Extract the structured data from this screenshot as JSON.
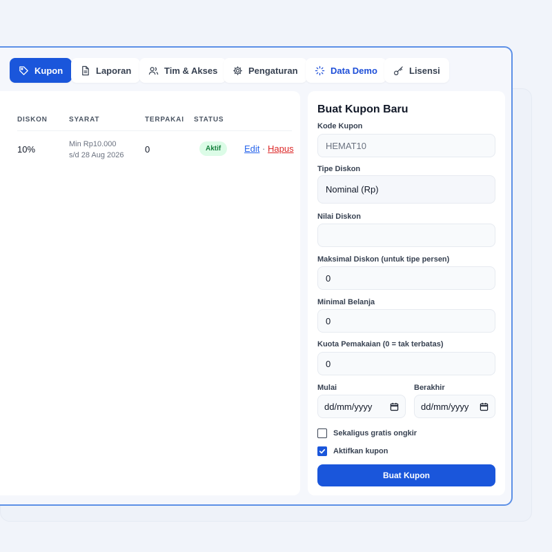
{
  "tabs": [
    {
      "label": "Kupon",
      "icon": "tag-icon"
    },
    {
      "label": "Laporan",
      "icon": "document-icon"
    },
    {
      "label": "Tim & Akses",
      "icon": "users-icon"
    },
    {
      "label": "Pengaturan",
      "icon": "gear-icon"
    },
    {
      "label": "Data Demo",
      "icon": "loader-icon"
    },
    {
      "label": "Lisensi",
      "icon": "key-icon"
    }
  ],
  "coupon_table": {
    "headers": {
      "discount": "DISKON",
      "terms": "SYARAT",
      "used": "TERPAKAI",
      "status": "STATUS"
    },
    "rows": [
      {
        "discount": "10%",
        "terms_min": "Min Rp10.000",
        "terms_until": "s/d 28 Aug 2026",
        "used": "0",
        "status": "Aktif",
        "edit": "Edit",
        "separator": "·",
        "delete": "Hapus"
      }
    ]
  },
  "form": {
    "title": "Buat Kupon Baru",
    "code_label": "Kode Kupon",
    "code_placeholder": "HEMAT10",
    "type_label": "Tipe Diskon",
    "type_value": "Nominal (Rp)",
    "value_label": "Nilai Diskon",
    "value_value": "",
    "max_label": "Maksimal Diskon (untuk tipe persen)",
    "max_value": "0",
    "min_label": "Minimal Belanja",
    "min_value": "0",
    "quota_label": "Kuota Pemakaian (0 = tak terbatas)",
    "quota_value": "0",
    "start_label": "Mulai",
    "start_value": "dd/mm/yyyy",
    "end_label": "Berakhir",
    "end_value": "dd/mm/yyyy",
    "free_shipping_label": "Sekaligus gratis ongkir",
    "free_shipping_checked": false,
    "activate_label": "Aktifkan kupon",
    "activate_checked": true,
    "submit_label": "Buat Kupon"
  },
  "colors": {
    "primary": "#1a56db",
    "active_badge": "#dcfce7",
    "delete_link": "#dc2626"
  }
}
